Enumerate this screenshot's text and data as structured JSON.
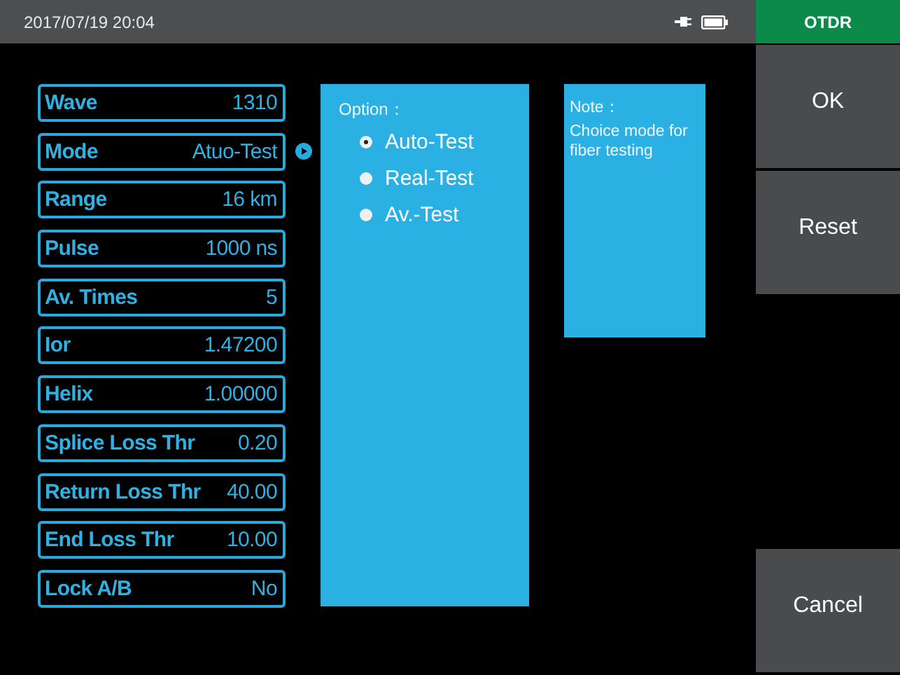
{
  "status_bar": {
    "datetime": "2017/07/19  20:04",
    "mode_label": "OTDR"
  },
  "parameters": [
    {
      "label": "Wave",
      "value": "1310",
      "selected": false
    },
    {
      "label": "Mode",
      "value": "Atuo-Test",
      "selected": true
    },
    {
      "label": "Range",
      "value": "16 km",
      "selected": false
    },
    {
      "label": "Pulse",
      "value": "1000 ns",
      "selected": false
    },
    {
      "label": "Av. Times",
      "value": "5",
      "selected": false
    },
    {
      "label": "Ior",
      "value": "1.47200",
      "selected": false
    },
    {
      "label": "Helix",
      "value": "1.00000",
      "selected": false
    },
    {
      "label": "Splice Loss Thr",
      "value": "0.20",
      "selected": false
    },
    {
      "label": "Return Loss Thr",
      "value": "40.00",
      "selected": false
    },
    {
      "label": "End Loss Thr",
      "value": "10.00",
      "selected": false
    },
    {
      "label": "Lock A/B",
      "value": "No",
      "selected": false
    }
  ],
  "option_panel": {
    "title": "Option：",
    "options": [
      {
        "label": "Auto-Test",
        "selected": true
      },
      {
        "label": "Real-Test",
        "selected": false
      },
      {
        "label": "Av.-Test",
        "selected": false
      }
    ]
  },
  "note_panel": {
    "title": "Note：",
    "text": "Choice mode for fiber testing"
  },
  "side_buttons": [
    {
      "label": "OK",
      "kind": "button"
    },
    {
      "label": "Reset",
      "kind": "button"
    },
    {
      "kind": "spacer"
    },
    {
      "label": "Cancel",
      "kind": "button"
    }
  ]
}
